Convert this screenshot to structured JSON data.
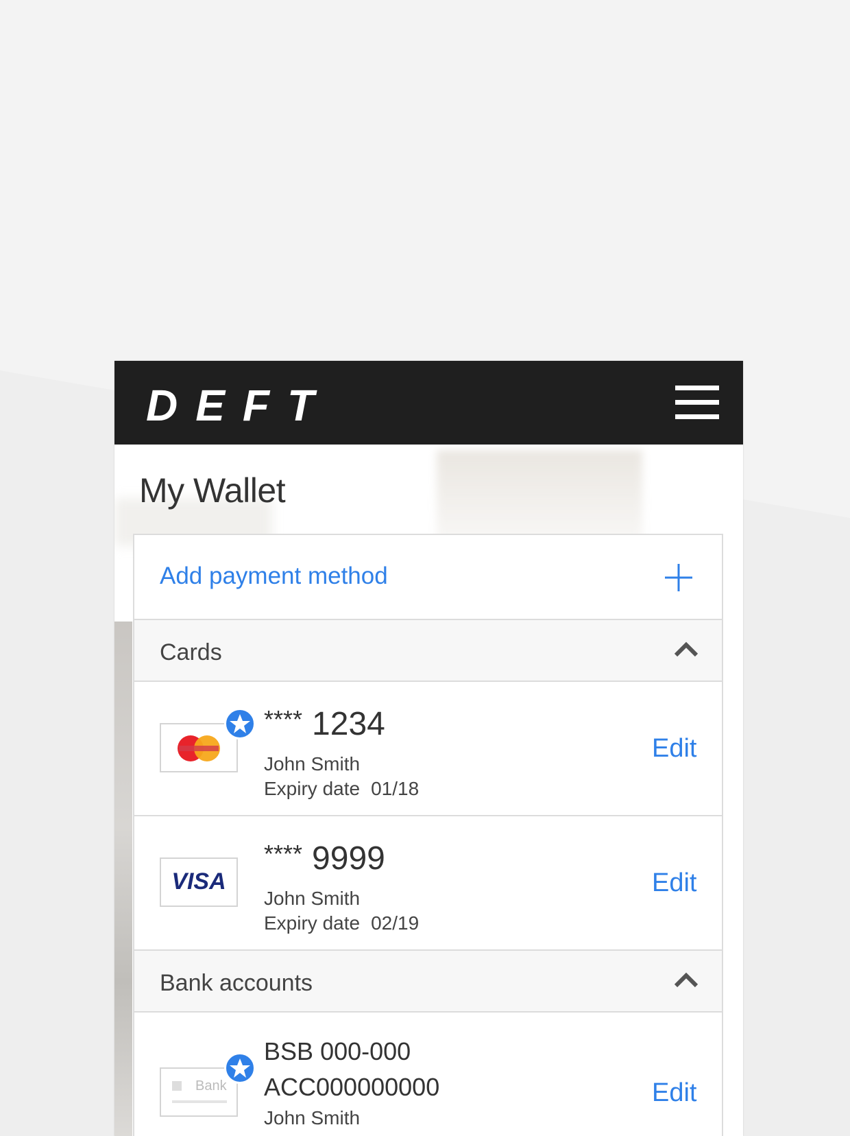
{
  "header": {
    "logo": "DEFT"
  },
  "page": {
    "title": "My Wallet"
  },
  "add_payment": {
    "label": "Add payment method"
  },
  "cards_section": {
    "title": "Cards",
    "items": [
      {
        "brand": "mastercard",
        "stars": "****",
        "number": "1234",
        "name": "John Smith",
        "expiry_label": "Expiry date",
        "expiry": "01/18",
        "edit": "Edit",
        "is_default": true
      },
      {
        "brand": "VISA",
        "stars": "****",
        "number": "9999",
        "name": "John Smith",
        "expiry_label": "Expiry date",
        "expiry": "02/19",
        "edit": "Edit",
        "is_default": false
      }
    ]
  },
  "bank_section": {
    "title": "Bank accounts",
    "items": [
      {
        "logo_text": "Bank",
        "bsb_label": "BSB",
        "bsb": "000-000",
        "acc_label": "ACC",
        "acc": "000000000",
        "name": "John Smith",
        "edit": "Edit",
        "is_default": true
      }
    ]
  },
  "colors": {
    "accent": "#2f80e8",
    "header_bg": "#1f1f1f",
    "text": "#333333"
  }
}
